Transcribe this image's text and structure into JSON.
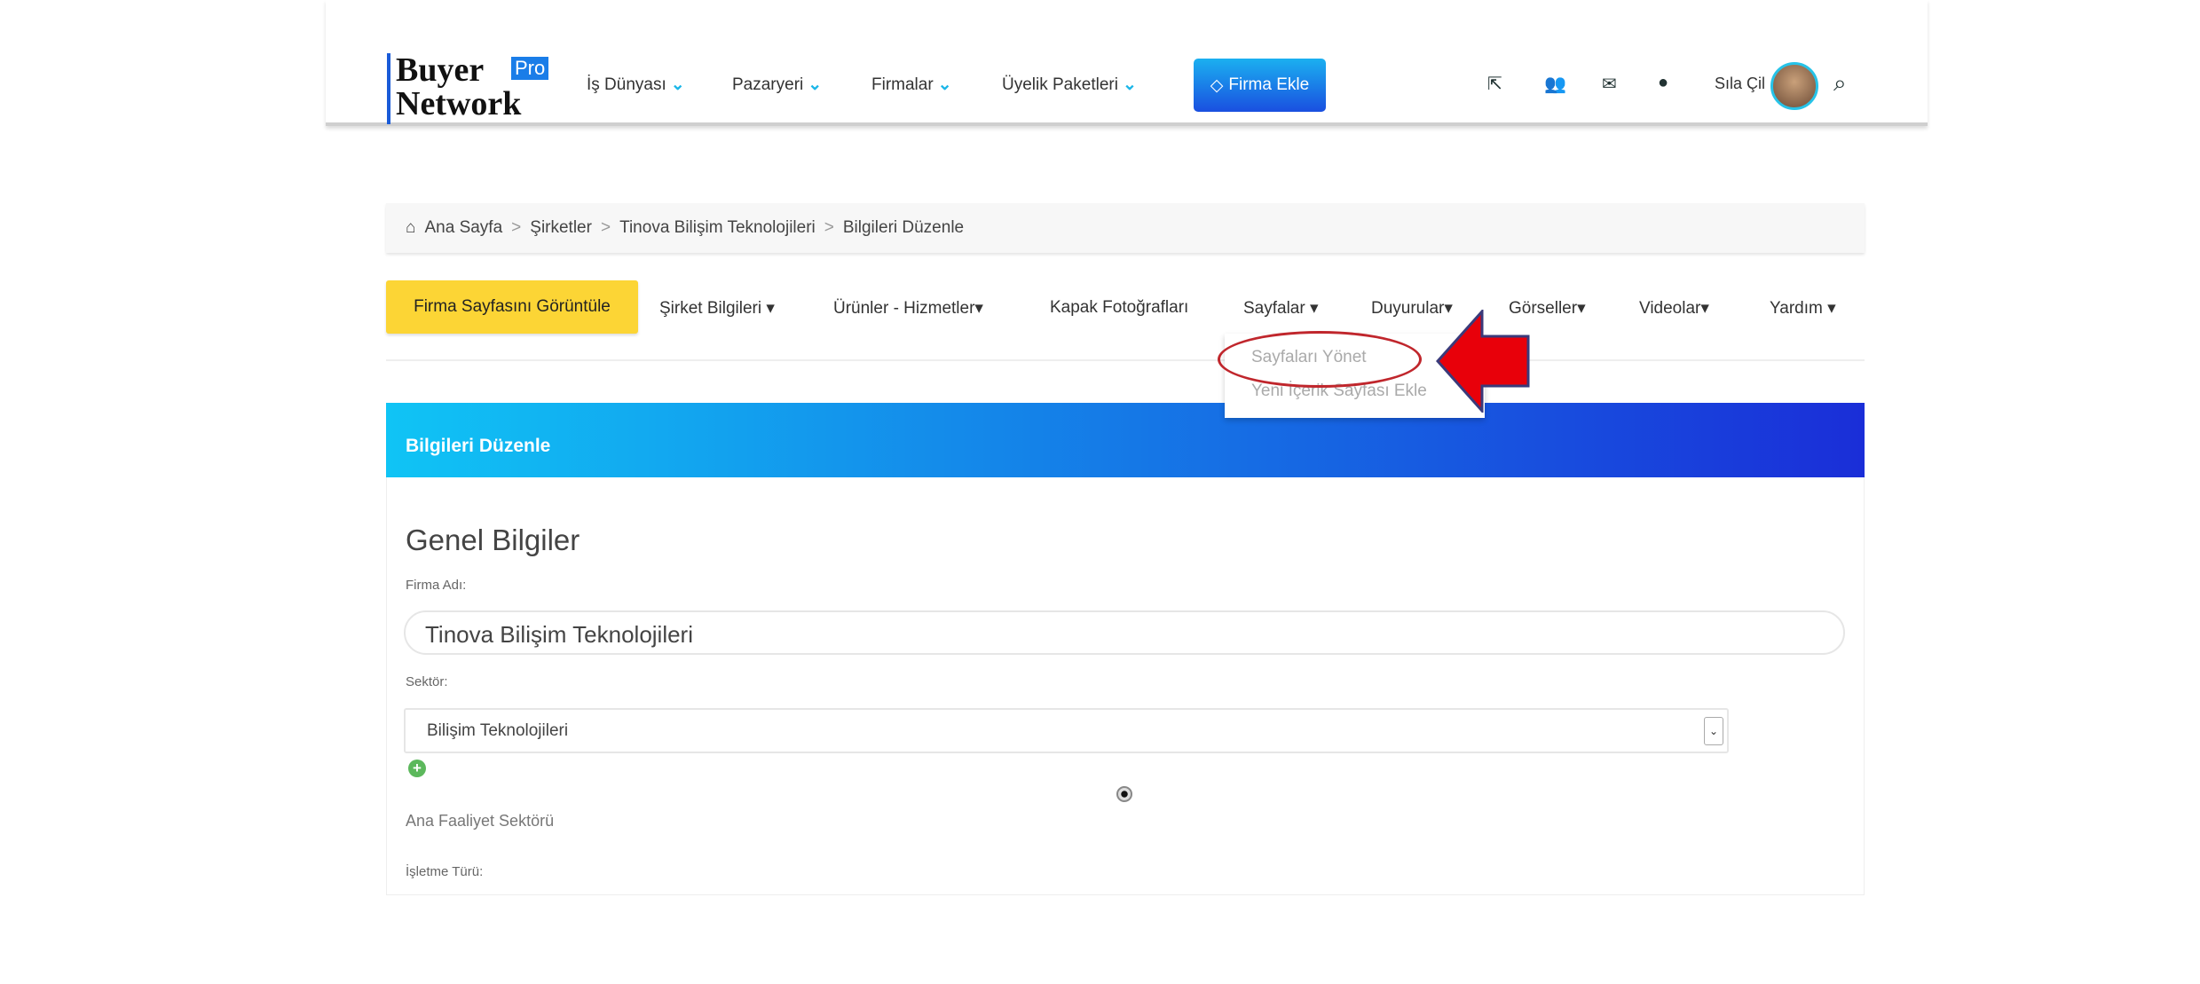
{
  "header": {
    "logo": {
      "line1": "Buyer",
      "line2": "Network",
      "badge": "Pro"
    },
    "nav": [
      {
        "label": "İş Dünyası"
      },
      {
        "label": "Pazaryeri"
      },
      {
        "label": "Firmalar"
      },
      {
        "label": "Üyelik Paketleri"
      }
    ],
    "cta": "Firma Ekle",
    "icons": [
      "external-link-icon",
      "users-icon",
      "envelope-icon",
      "globe-icon"
    ],
    "user": "Sıla Çil",
    "accent": "#1ab6e8"
  },
  "breadcrumb": [
    "Ana Sayfa",
    "Şirketler",
    "Tinova Bilişim Teknolojileri",
    "Bilgileri Düzenle"
  ],
  "tabs": {
    "primary": "Firma Sayfasını Görüntüle",
    "items": [
      {
        "label": "Şirket Bilgileri ▾"
      },
      {
        "label": "Ürünler - Hizmetler▾"
      },
      {
        "label": "Kapak Fotoğrafları"
      },
      {
        "label": "Sayfalar ▾"
      },
      {
        "label": "Duyurular▾"
      },
      {
        "label": "Görseller▾"
      },
      {
        "label": "Videolar▾"
      },
      {
        "label": "Yardım ▾"
      }
    ]
  },
  "dropdown": [
    "Sayfaları Yönet",
    "Yeni İçerik Sayfası Ekle"
  ],
  "panel": {
    "title": "Bilgileri Düzenle",
    "section": "Genel Bilgiler",
    "firma_label": "Firma Adı:",
    "firma_value": "Tinova Bilişim Teknolojileri",
    "sektor_label": "Sektör:",
    "sektor_value": "Bilişim Teknolojileri",
    "ana_faaliyet": "Ana Faaliyet Sektörü",
    "isletme_label": "İşletme Türü:"
  },
  "annotation_color": "#e8000a"
}
